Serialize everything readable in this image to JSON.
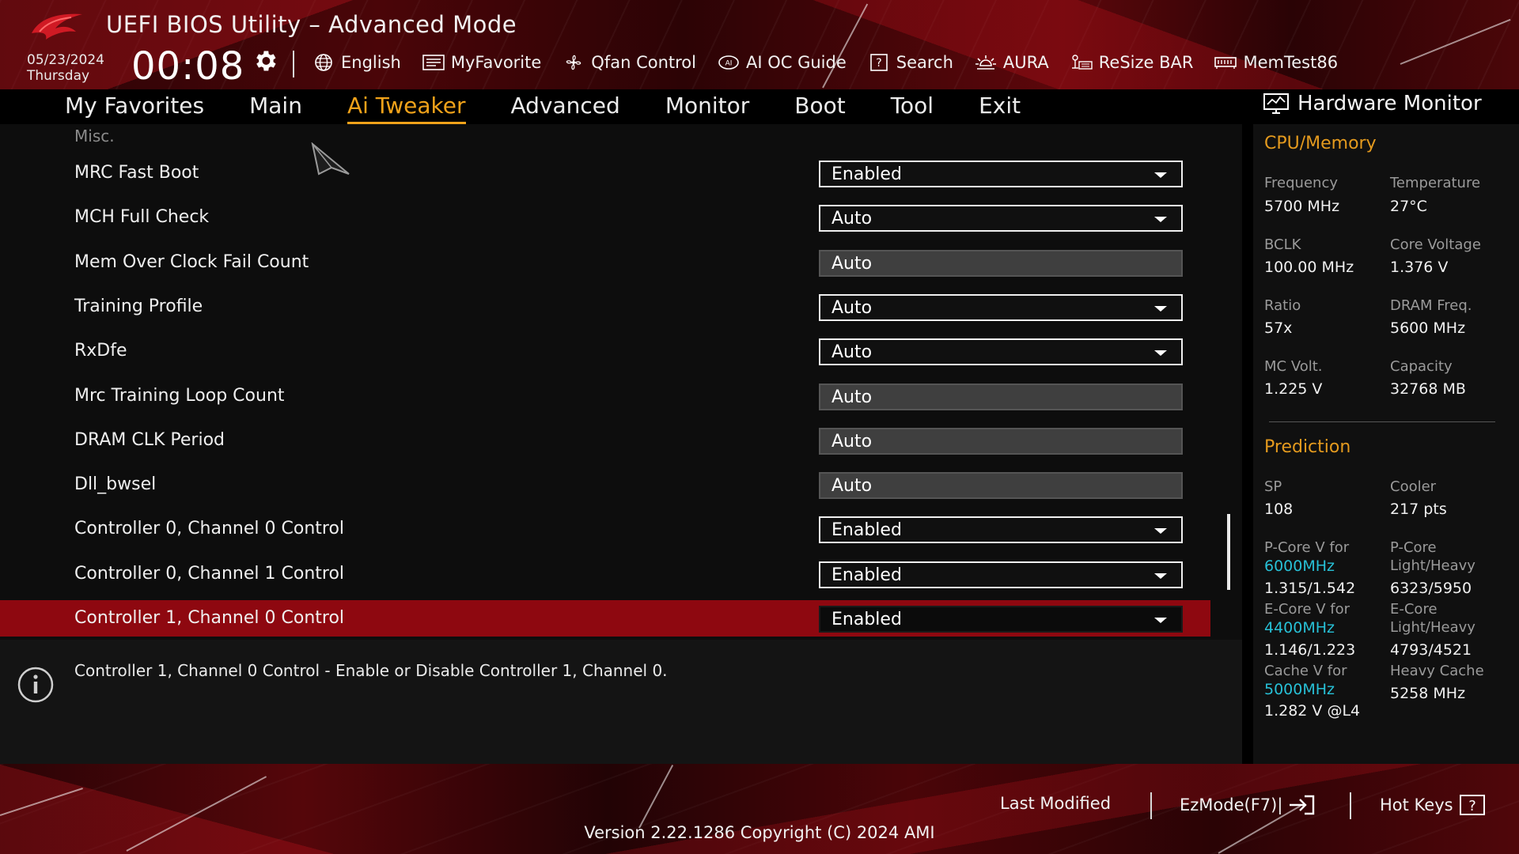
{
  "app_title": "UEFI BIOS Utility – Advanced Mode",
  "date": "05/23/2024",
  "weekday": "Thursday",
  "time": "00:08",
  "colors": {
    "accent": "#f0a21a",
    "selected_row": "#8e0810",
    "cyan": "#27c0d6",
    "section": "#e49a1e"
  },
  "toolbar": [
    {
      "label": "English",
      "icon": "globe-icon"
    },
    {
      "label": "MyFavorite",
      "icon": "favorite-list-icon"
    },
    {
      "label": "Qfan Control",
      "icon": "fan-icon"
    },
    {
      "label": "AI OC Guide",
      "icon": "ai-chip-icon"
    },
    {
      "label": "Search",
      "icon": "help-box-icon"
    },
    {
      "label": "AURA",
      "icon": "aura-light-icon"
    },
    {
      "label": "ReSize BAR",
      "icon": "resize-bar-icon"
    },
    {
      "label": "MemTest86",
      "icon": "memory-icon"
    }
  ],
  "tabs": [
    "My Favorites",
    "Main",
    "Ai Tweaker",
    "Advanced",
    "Monitor",
    "Boot",
    "Tool",
    "Exit"
  ],
  "active_tab": "Ai Tweaker",
  "section_label": "Misc.",
  "settings": [
    {
      "label": "MRC Fast Boot",
      "value": "Enabled",
      "kind": "dropdown"
    },
    {
      "label": "MCH Full Check",
      "value": "Auto",
      "kind": "dropdown"
    },
    {
      "label": "Mem Over Clock Fail Count",
      "value": "Auto",
      "kind": "field"
    },
    {
      "label": "Training Profile",
      "value": "Auto",
      "kind": "dropdown"
    },
    {
      "label": "RxDfe",
      "value": "Auto",
      "kind": "dropdown"
    },
    {
      "label": "Mrc Training Loop Count",
      "value": "Auto",
      "kind": "field"
    },
    {
      "label": "DRAM CLK Period",
      "value": "Auto",
      "kind": "field"
    },
    {
      "label": "Dll_bwsel",
      "value": "Auto",
      "kind": "field"
    },
    {
      "label": "Controller 0, Channel 0 Control",
      "value": "Enabled",
      "kind": "dropdown"
    },
    {
      "label": "Controller 0, Channel 1 Control",
      "value": "Enabled",
      "kind": "dropdown"
    },
    {
      "label": "Controller 1, Channel 0 Control",
      "value": "Enabled",
      "kind": "dropdown",
      "selected": true
    }
  ],
  "help_text": "Controller 1, Channel 0 Control - Enable or Disable Controller 1, Channel 0.",
  "hw_monitor": {
    "title": "Hardware Monitor",
    "cpu_memory": {
      "title": "CPU/Memory",
      "items": [
        {
          "label": "Frequency",
          "value": "5700 MHz"
        },
        {
          "label": "Temperature",
          "value": "27°C"
        },
        {
          "label": "BCLK",
          "value": "100.00 MHz"
        },
        {
          "label": "Core Voltage",
          "value": "1.376 V"
        },
        {
          "label": "Ratio",
          "value": "57x"
        },
        {
          "label": "DRAM Freq.",
          "value": "5600 MHz"
        },
        {
          "label": "MC Volt.",
          "value": "1.225 V"
        },
        {
          "label": "Capacity",
          "value": "32768 MB"
        }
      ]
    },
    "prediction": {
      "title": "Prediction",
      "sp_label": "SP",
      "sp_value": "108",
      "cooler_label": "Cooler",
      "cooler_value": "217 pts",
      "pcore_v_label": "P-Core V for",
      "pcore_v_freq": "6000MHz",
      "pcore_v_value": "1.315/1.542",
      "pcore_lh_label1": "P-Core",
      "pcore_lh_label2": "Light/Heavy",
      "pcore_lh_value": "6323/5950",
      "ecore_v_label": "E-Core V for",
      "ecore_v_freq": "4400MHz",
      "ecore_v_value": "1.146/1.223",
      "ecore_lh_label1": "E-Core",
      "ecore_lh_label2": "Light/Heavy",
      "ecore_lh_value": "4793/4521",
      "cache_v_label": "Cache V for",
      "cache_v_freq": "5000MHz",
      "cache_v_value": "1.282 V @L4",
      "heavy_cache_label": "Heavy Cache",
      "heavy_cache_value": "5258 MHz"
    }
  },
  "footer": {
    "last_modified": "Last Modified",
    "ezmode": "EzMode(F7)|",
    "hotkeys": "Hot Keys",
    "version": "Version 2.22.1286 Copyright (C) 2024 AMI"
  }
}
